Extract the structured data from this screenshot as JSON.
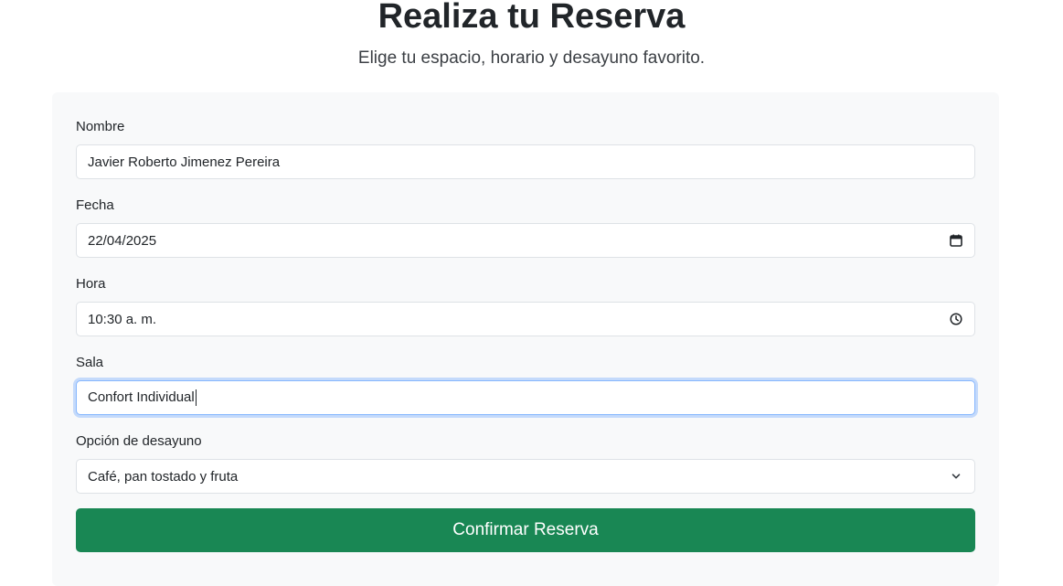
{
  "header": {
    "title": "Realiza tu Reserva",
    "subtitle": "Elige tu espacio, horario y desayuno favorito."
  },
  "form": {
    "name": {
      "label": "Nombre",
      "value": "Javier Roberto Jimenez Pereira"
    },
    "date": {
      "label": "Fecha",
      "value": "22/04/2025",
      "icon": "calendar-icon"
    },
    "time": {
      "label": "Hora",
      "value": "10:30 a. m.",
      "icon": "clock-icon"
    },
    "room": {
      "label": "Sala",
      "value": "Confort Individual"
    },
    "breakfast": {
      "label": "Opción de desayuno",
      "value": "Café, pan tostado y fruta",
      "icon": "chevron-down-icon"
    },
    "submit_label": "Confirmar Reserva"
  },
  "colors": {
    "accent": "#198754",
    "focus_ring": "#86b7fe",
    "card_background": "#f8f9fa"
  }
}
